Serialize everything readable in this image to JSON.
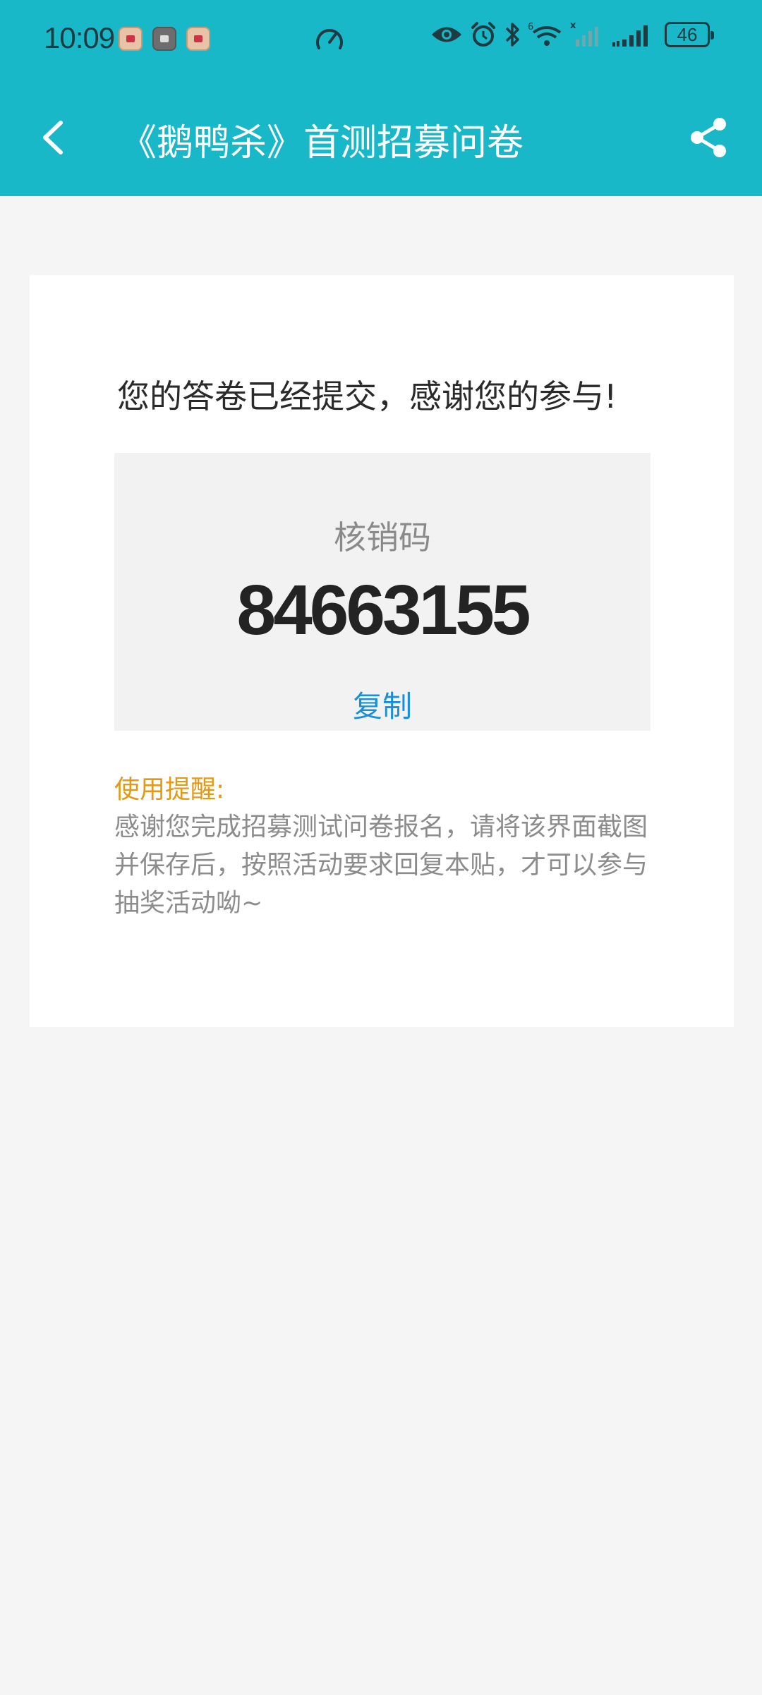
{
  "status_bar": {
    "time": "10:09",
    "battery_level": "46",
    "icons": [
      "app-notification-icon",
      "image-notification-icon",
      "app-notification-icon",
      "speed-icon",
      "eye-icon",
      "alarm-icon",
      "bluetooth-icon",
      "wifi-icon",
      "signal-icon",
      "signal-icon",
      "battery-icon"
    ]
  },
  "nav": {
    "title": "《鹅鸭杀》首测招募问卷",
    "back_icon": "chevron-left-icon",
    "share_icon": "share-icon"
  },
  "result": {
    "thanks_message": "您的答卷已经提交，感谢您的参与!",
    "code_label": "核销码",
    "code_value": "84663155",
    "copy_label": "复制",
    "reminder_title": "使用提醒:",
    "reminder_body": "感谢您完成招募测试问卷报名，请将该界面截图并保存后，按照活动要求回复本贴，才可以参与抽奖活动呦~"
  },
  "colors": {
    "header": "#18b8c8",
    "accent_link": "#1a8fd8",
    "reminder_title": "#e39a12"
  }
}
